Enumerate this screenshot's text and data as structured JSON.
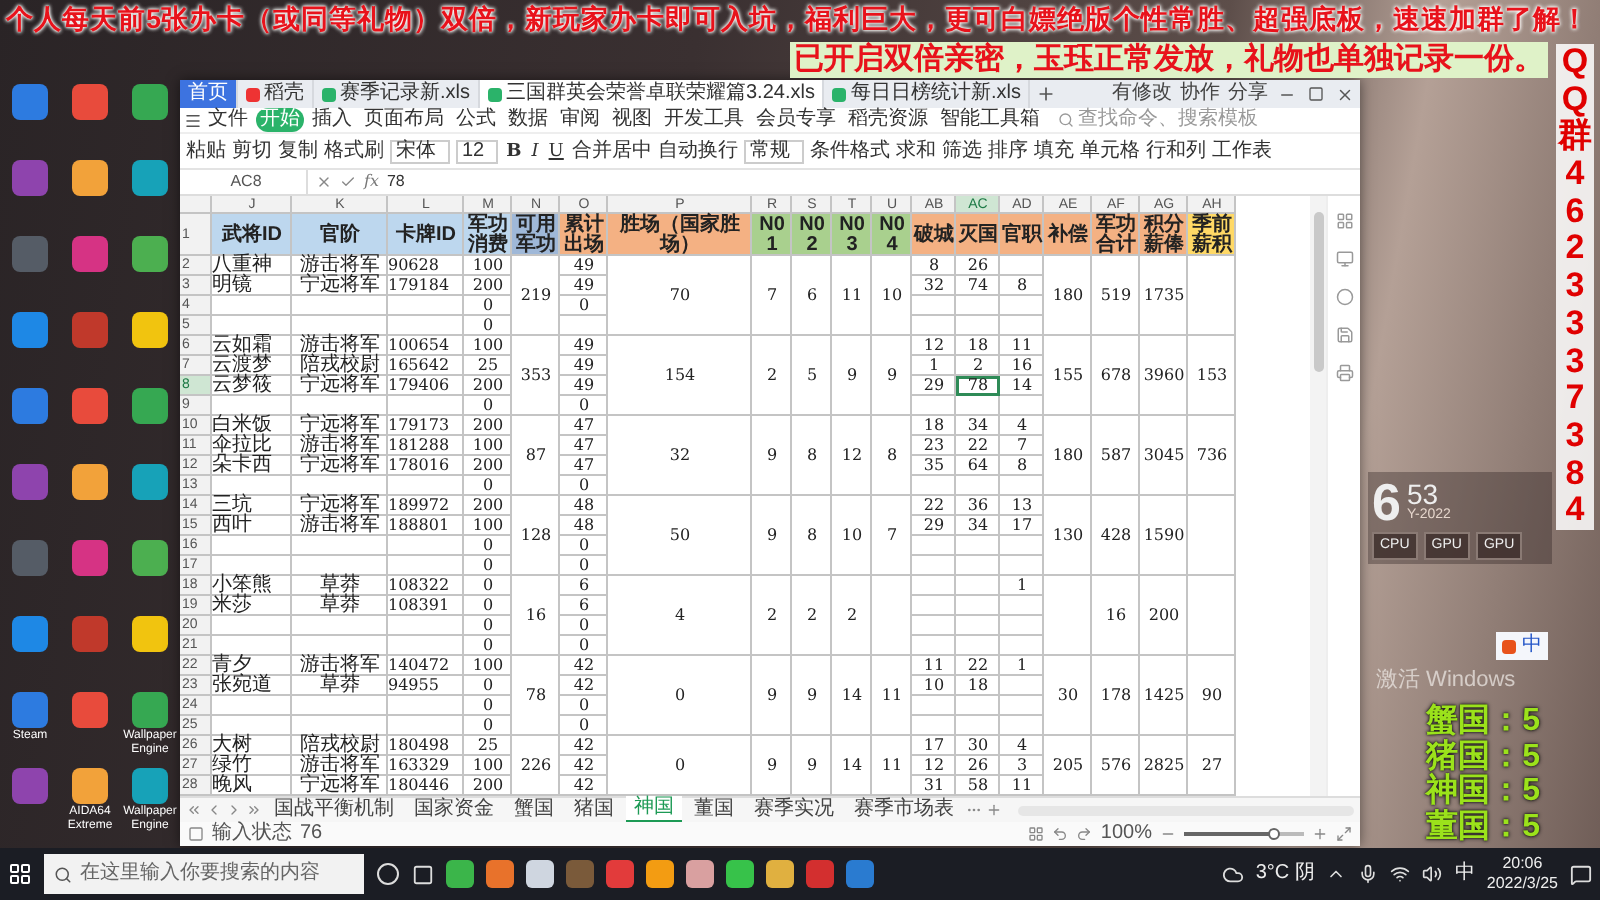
{
  "banner": {
    "lines": [
      "个人每天前5张办卡（或同等礼物）双倍，新玩家办卡即可入坑，福利巨大，更可白嫖绝版个性常胜、超强底板，速速加群了解！",
      "已开启双倍亲密，玉珏正常发放，礼物也单独记录一份。"
    ]
  },
  "qq_column": "QQ群4623337384",
  "desktop_icons": [
    {
      "kind": "app"
    },
    {
      "kind": "app"
    },
    {
      "kind": "app"
    },
    {
      "kind": "app"
    },
    {
      "kind": "app"
    },
    {
      "kind": "app"
    },
    {
      "kind": "app"
    },
    {
      "kind": "app"
    },
    {
      "kind": "app"
    },
    {
      "kind": "app"
    },
    {
      "kind": "app"
    },
    {
      "kind": "app"
    },
    {
      "kind": "app"
    },
    {
      "kind": "app"
    },
    {
      "kind": "app"
    },
    {
      "kind": "app"
    },
    {
      "kind": "app"
    },
    {
      "kind": "app"
    },
    {
      "kind": "app"
    },
    {
      "kind": "app"
    },
    {
      "kind": "app"
    },
    {
      "kind": "app"
    },
    {
      "kind": "app"
    },
    {
      "kind": "app"
    },
    {
      "kind": "app",
      "label": "Steam"
    },
    {
      "kind": "app"
    },
    {
      "kind": "app",
      "label": "Wallpaper Engine"
    },
    {
      "kind": "app"
    },
    {
      "kind": "app",
      "label": "AIDA64 Extreme"
    },
    {
      "kind": "app",
      "label": "Wallpaper Engine"
    }
  ],
  "window": {
    "tabs": [
      {
        "label": "首页",
        "kind": "home",
        "selected": false
      },
      {
        "label": "稻壳",
        "kind": "docer",
        "selected": false
      },
      {
        "label": "赛季记录新.xls",
        "kind": "sheet",
        "selected": false
      },
      {
        "label": "三国群英会荣誉卓联荣耀篇3.24.xls",
        "kind": "sheet",
        "selected": true
      },
      {
        "label": "每日日榜统计新.xls",
        "kind": "sheet",
        "selected": false
      }
    ],
    "actions": [
      "有修改",
      "协作",
      "分享"
    ],
    "menu": [
      {
        "label": "文件",
        "selected": false
      },
      {
        "label": "开始",
        "selected": true
      },
      {
        "label": "插入",
        "selected": false
      },
      {
        "label": "页面布局",
        "selected": false
      },
      {
        "label": "公式",
        "selected": false
      },
      {
        "label": "数据",
        "selected": false
      },
      {
        "label": "审阅",
        "selected": false
      },
      {
        "label": "视图",
        "selected": false
      },
      {
        "label": "开发工具",
        "selected": false
      },
      {
        "label": "会员专享",
        "selected": false
      },
      {
        "label": "稻壳资源",
        "selected": false
      },
      {
        "label": "智能工具箱",
        "selected": false
      }
    ],
    "search": {
      "placeholder": "查找命令、搜索模板"
    },
    "ribbon": [
      {
        "kind": "button",
        "label": "粘贴"
      },
      {
        "kind": "button",
        "label": "剪切"
      },
      {
        "kind": "button",
        "label": "复制"
      },
      {
        "kind": "button",
        "label": "格式刷"
      },
      {
        "kind": "dropdown",
        "label": "宋体"
      },
      {
        "kind": "dropdown",
        "label": "12"
      },
      {
        "kind": "bold",
        "label": "B"
      },
      {
        "kind": "italic",
        "label": "I"
      },
      {
        "kind": "underline",
        "label": "U"
      },
      {
        "kind": "button",
        "label": "合并居中"
      },
      {
        "kind": "button",
        "label": "自动换行"
      },
      {
        "kind": "dropdown",
        "label": "常规"
      },
      {
        "kind": "button",
        "label": "条件格式"
      },
      {
        "kind": "button",
        "label": "求和"
      },
      {
        "kind": "button",
        "label": "筛选"
      },
      {
        "kind": "button",
        "label": "排序"
      },
      {
        "kind": "button",
        "label": "填充"
      },
      {
        "kind": "button",
        "label": "单元格"
      },
      {
        "kind": "button",
        "label": "行和列"
      },
      {
        "kind": "button",
        "label": "工作表"
      }
    ],
    "formula": {
      "cell": "AC8",
      "function_label": "fx",
      "value": "78"
    },
    "columns": [
      {
        "letter": "J",
        "selected": false
      },
      {
        "letter": "K",
        "selected": false
      },
      {
        "letter": "L",
        "selected": false
      },
      {
        "letter": "M",
        "selected": false
      },
      {
        "letter": "N",
        "selected": false
      },
      {
        "letter": "O",
        "selected": false
      },
      {
        "letter": "P",
        "selected": false
      },
      {
        "letter": "R",
        "selected": false
      },
      {
        "letter": "S",
        "selected": false
      },
      {
        "letter": "T",
        "selected": false
      },
      {
        "letter": "U",
        "selected": false
      },
      {
        "letter": "AB",
        "selected": false
      },
      {
        "letter": "AC",
        "selected": true
      },
      {
        "letter": "AD",
        "selected": false
      },
      {
        "letter": "AE",
        "selected": false
      },
      {
        "letter": "AF",
        "selected": false
      },
      {
        "letter": "AG",
        "selected": false
      },
      {
        "letter": "AH",
        "selected": false
      }
    ],
    "header_row": "1",
    "headers": [
      {
        "text": "武将ID",
        "color": "#bdd7ee"
      },
      {
        "text": "官阶",
        "color": "#bdd7ee"
      },
      {
        "text": "卡牌ID",
        "color": "#bdd7ee"
      },
      {
        "text": "军功消费",
        "color": "#bdd7ee"
      },
      {
        "text": "可用军功",
        "color": "#9fb8d8"
      },
      {
        "text": "累计出场",
        "color": "#f4b183"
      },
      {
        "text": "胜场（国家胜场）",
        "color": "#f4b183"
      },
      {
        "text": "N01",
        "color": "#a9d08e"
      },
      {
        "text": "N02",
        "color": "#a9d08e"
      },
      {
        "text": "N03",
        "color": "#a9d08e"
      },
      {
        "text": "N04",
        "color": "#a9d08e"
      },
      {
        "text": "破城",
        "color": "#f4b183"
      },
      {
        "text": "灭国",
        "color": "#f4b183"
      },
      {
        "text": "官职",
        "color": "#f4b183"
      },
      {
        "text": "补偿",
        "color": "#f4b183"
      },
      {
        "text": "军功合计",
        "color": "#f4b183"
      },
      {
        "text": "积分薪俸",
        "color": "#f4b183"
      },
      {
        "text": "季前薪积",
        "color": "#ffd966"
      }
    ],
    "groups": [
      {
        "available": "219",
        "wins": "70",
        "n01": "7",
        "n02": "6",
        "n03": "11",
        "n04": "10",
        "comp": "180",
        "total": "519",
        "salary": "1735",
        "rows": [
          {
            "num": "2",
            "name": "八重神",
            "rank": "游击将军",
            "card": "90628",
            "cost": "100",
            "played": "49",
            "ab": "8",
            "ac": "26",
            "selected": false
          },
          {
            "num": "3",
            "name": "明镜",
            "rank": "宁远将军",
            "card": "179184",
            "cost": "200",
            "played": "49",
            "ab": "32",
            "ac": "74",
            "ad": "8",
            "selected": false
          },
          {
            "num": "4",
            "cost": "0",
            "played": "0",
            "selected": false
          },
          {
            "num": "5",
            "cost": "0",
            "selected": false
          }
        ]
      },
      {
        "available": "353",
        "wins": "154",
        "n01": "2",
        "n02": "5",
        "n03": "9",
        "n04": "9",
        "comp": "155",
        "total": "678",
        "salary": "3960",
        "pre": "153",
        "rows": [
          {
            "num": "6",
            "name": "云如霜",
            "rank": "游击将军",
            "card": "100654",
            "cost": "100",
            "played": "49",
            "ab": "12",
            "ac": "18",
            "ad": "11",
            "selected": false
          },
          {
            "num": "7",
            "name": "云渡梦",
            "rank": "陪戎校尉",
            "card": "165642",
            "cost": "25",
            "played": "49",
            "ab": "1",
            "ac": "2",
            "ad": "16",
            "selected": false
          },
          {
            "num": "8",
            "name": "云梦筱",
            "rank": "宁远将军",
            "card": "179406",
            "cost": "200",
            "played": "49",
            "ab": "29",
            "ac": "78",
            "ad": "14",
            "selected": true
          },
          {
            "num": "9",
            "cost": "0",
            "played": "0",
            "selected": false
          }
        ]
      },
      {
        "available": "87",
        "wins": "32",
        "n01": "9",
        "n02": "8",
        "n03": "12",
        "n04": "8",
        "comp": "180",
        "total": "587",
        "salary": "3045",
        "pre": "736",
        "rows": [
          {
            "num": "10",
            "name": "白米饭",
            "rank": "宁远将军",
            "card": "179173",
            "cost": "200",
            "played": "47",
            "ab": "18",
            "ac": "34",
            "ad": "4",
            "selected": false
          },
          {
            "num": "11",
            "name": "伞拉比",
            "rank": "游击将军",
            "card": "181288",
            "cost": "100",
            "played": "47",
            "ab": "23",
            "ac": "22",
            "ad": "7",
            "selected": false
          },
          {
            "num": "12",
            "name": "朵卡西",
            "rank": "宁远将军",
            "card": "178016",
            "cost": "200",
            "played": "47",
            "ab": "35",
            "ac": "64",
            "ad": "8",
            "selected": false
          },
          {
            "num": "13",
            "cost": "0",
            "played": "0",
            "selected": false
          }
        ]
      },
      {
        "available": "128",
        "wins": "50",
        "n01": "9",
        "n02": "8",
        "n03": "10",
        "n04": "7",
        "comp": "130",
        "total": "428",
        "salary": "1590",
        "rows": [
          {
            "num": "14",
            "name": "三坑",
            "rank": "宁远将军",
            "card": "189972",
            "cost": "200",
            "played": "48",
            "ab": "22",
            "ac": "36",
            "ad": "13",
            "selected": false
          },
          {
            "num": "15",
            "name": "西叶",
            "rank": "游击将军",
            "card": "188801",
            "cost": "100",
            "played": "48",
            "ab": "29",
            "ac": "34",
            "ad": "17",
            "selected": false
          },
          {
            "num": "16",
            "cost": "0",
            "played": "0",
            "selected": false
          },
          {
            "num": "17",
            "cost": "0",
            "played": "0",
            "selected": false
          }
        ]
      },
      {
        "available": "16",
        "wins": "4",
        "n01": "2",
        "n02": "2",
        "n03": "2",
        "total": "16",
        "salary": "200",
        "rows": [
          {
            "num": "18",
            "name": "小笨熊",
            "rank": "草莽",
            "card": "108322",
            "cost": "0",
            "played": "6",
            "ad": "1",
            "selected": false
          },
          {
            "num": "19",
            "name": "米莎",
            "rank": "草莽",
            "card": "108391",
            "cost": "0",
            "played": "6",
            "selected": false
          },
          {
            "num": "20",
            "cost": "0",
            "played": "0",
            "selected": false
          },
          {
            "num": "21",
            "cost": "0",
            "played": "0",
            "selected": false
          }
        ]
      },
      {
        "available": "78",
        "wins": "0",
        "n01": "9",
        "n02": "9",
        "n03": "14",
        "n04": "11",
        "comp": "30",
        "total": "178",
        "salary": "1425",
        "pre": "90",
        "rows": [
          {
            "num": "22",
            "name": "青夕",
            "rank": "游击将军",
            "card": "140472",
            "cost": "100",
            "played": "42",
            "ab": "11",
            "ac": "22",
            "ad": "1",
            "selected": false
          },
          {
            "num": "23",
            "name": "张宛道",
            "rank": "草莽",
            "card": "94955",
            "cost": "0",
            "played": "42",
            "ab": "10",
            "ac": "18",
            "selected": false
          },
          {
            "num": "24",
            "cost": "0",
            "played": "0",
            "selected": false
          },
          {
            "num": "25",
            "cost": "0",
            "played": "0",
            "selected": false
          }
        ]
      },
      {
        "available": "226",
        "wins": "0",
        "n01": "9",
        "n02": "9",
        "n03": "14",
        "n04": "11",
        "comp": "205",
        "total": "576",
        "salary": "2825",
        "pre": "27",
        "rows": [
          {
            "num": "26",
            "name": "大树",
            "rank": "陪戎校尉",
            "card": "180498",
            "cost": "25",
            "played": "42",
            "ab": "17",
            "ac": "30",
            "ad": "4",
            "selected": false
          },
          {
            "num": "27",
            "name": "绿竹",
            "rank": "游击将军",
            "card": "163329",
            "cost": "100",
            "played": "42",
            "ab": "12",
            "ac": "26",
            "ad": "3",
            "selected": false
          },
          {
            "num": "28",
            "name": "晚风",
            "rank": "宁远将军",
            "card": "180446",
            "cost": "200",
            "played": "42",
            "ab": "31",
            "ac": "58",
            "ad": "11",
            "selected": false
          }
        ]
      }
    ],
    "sheet_tabs": [
      {
        "label": "国战平衡机制",
        "selected": false
      },
      {
        "label": "国家资金",
        "selected": false
      },
      {
        "label": "蟹国",
        "selected": false
      },
      {
        "label": "猪国",
        "selected": false
      },
      {
        "label": "神国",
        "selected": true
      },
      {
        "label": "董国",
        "selected": false
      },
      {
        "label": "赛季实况",
        "selected": false
      },
      {
        "label": "赛季市场表",
        "selected": false
      }
    ],
    "status": {
      "label": "输入状态",
      "value": "76",
      "zoom": "100%",
      "level": 0.75
    }
  },
  "widget": {
    "hour": "6",
    "minute": "53",
    "year": "Y-2022",
    "meters": [
      "CPU",
      "GPU",
      "GPU"
    ]
  },
  "ime": {
    "label": "中"
  },
  "activation": "激活 Windows",
  "nation_scores": [
    "蟹国：5",
    "猪国：5",
    "神国：5",
    "董国：5"
  ],
  "taskbar": {
    "search_placeholder": "在这里输入你要搜索的内容",
    "weather": "3°C 阴",
    "ime": "中",
    "time": "20:06",
    "date": "2022/3/25"
  }
}
